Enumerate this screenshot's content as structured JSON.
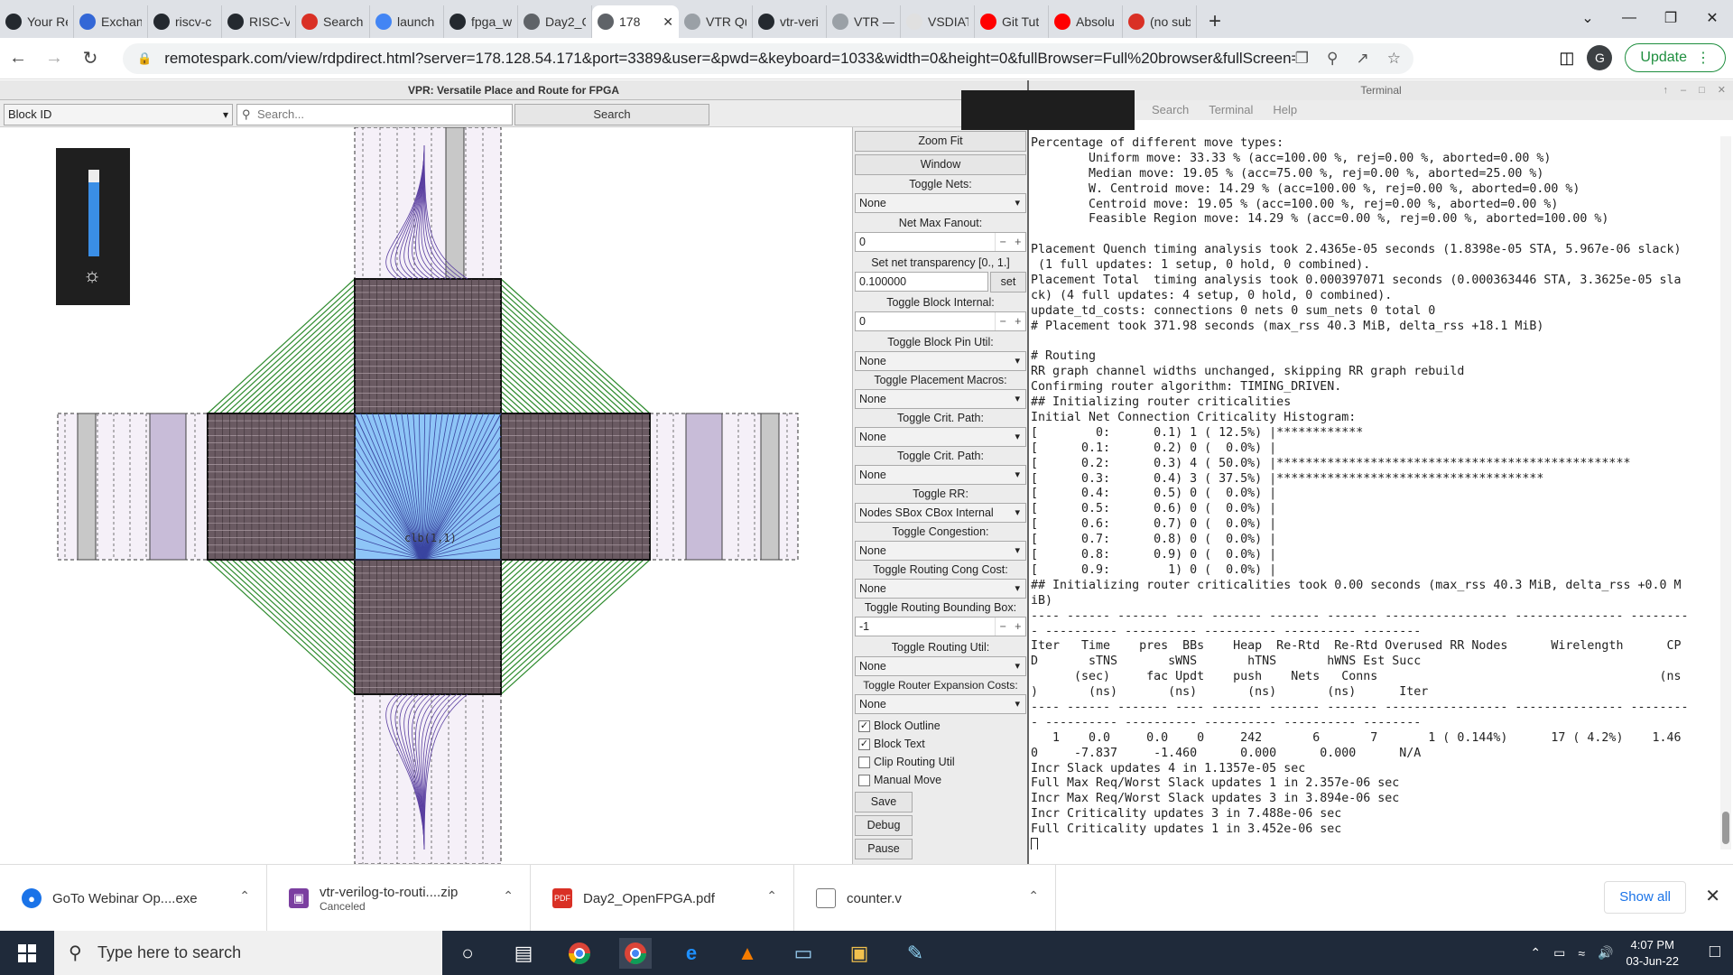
{
  "browser": {
    "tabs": [
      {
        "label": "Your Re",
        "icon": "github-icon",
        "color": "#24292f"
      },
      {
        "label": "Exchan",
        "icon": "exchange-icon",
        "color": "#3367d6"
      },
      {
        "label": "riscv-c",
        "icon": "github-icon",
        "color": "#24292f"
      },
      {
        "label": "RISC-V",
        "icon": "github-icon",
        "color": "#24292f"
      },
      {
        "label": "Search",
        "icon": "gmail-icon",
        "color": "#d93025"
      },
      {
        "label": "launch",
        "icon": "google-icon",
        "color": "#4285f4"
      },
      {
        "label": "fpga_w",
        "icon": "github-icon",
        "color": "#24292f"
      },
      {
        "label": "Day2_C",
        "icon": "globe-icon",
        "color": "#5f6368"
      },
      {
        "label": "178",
        "icon": "globe-icon",
        "color": "#5f6368",
        "active": true
      },
      {
        "label": "VTR Qu",
        "icon": "grid-icon",
        "color": "#9aa0a6"
      },
      {
        "label": "vtr-veri",
        "icon": "github-icon",
        "color": "#24292f"
      },
      {
        "label": "VTR —",
        "icon": "grid-icon",
        "color": "#9aa0a6"
      },
      {
        "label": "VSDIAT",
        "icon": "page-icon",
        "color": "#e0e0e0"
      },
      {
        "label": "Git Tut",
        "icon": "youtube-icon",
        "color": "#ff0000"
      },
      {
        "label": "Absolu",
        "icon": "youtube-icon",
        "color": "#ff0000"
      },
      {
        "label": "(no sub",
        "icon": "gmail-icon",
        "color": "#d93025"
      }
    ],
    "url": "remotespark.com/view/rdpdirect.html?server=178.128.54.171&port=3389&user=&pwd=&keyboard=1033&width=0&height=0&fullBrowser=Full%20browser&fullScreen=Full%...",
    "avatar_letter": "G",
    "update_label": "Update"
  },
  "vpr": {
    "title": "VPR: Versatile Place and Route for FPGA",
    "block_select": "Block ID",
    "search_placeholder": "Search...",
    "search_button": "Search",
    "canvas_label": "clb(1,1)",
    "panel": {
      "zoom_fit": "Zoom Fit",
      "window": "Window",
      "toggle_nets_label": "Toggle Nets:",
      "toggle_nets_value": "None",
      "net_max_fanout_label": "Net Max Fanout:",
      "net_max_fanout_value": "0",
      "net_transparency_label": "Set net transparency [0., 1.]",
      "net_transparency_value": "0.100000",
      "set_button": "set",
      "toggle_block_internal_label": "Toggle Block Internal:",
      "toggle_block_internal_value": "0",
      "toggle_block_pin_util_label": "Toggle Block Pin Util:",
      "toggle_block_pin_util_value": "None",
      "toggle_placement_macros_label": "Toggle Placement Macros:",
      "toggle_placement_macros_value": "None",
      "toggle_crit_path_label": "Toggle Crit. Path:",
      "toggle_crit_path_value": "None",
      "toggle_crit_path2_label": "Toggle Crit. Path:",
      "toggle_crit_path2_value": "None",
      "toggle_rr_label": "Toggle RR:",
      "toggle_rr_value": "Nodes SBox CBox Internal",
      "toggle_congestion_label": "Toggle Congestion:",
      "toggle_congestion_value": "None",
      "toggle_routing_cong_cost_label": "Toggle Routing Cong Cost:",
      "toggle_routing_cong_cost_value": "None",
      "toggle_routing_bbox_label": "Toggle Routing Bounding Box:",
      "toggle_routing_bbox_value": "-1",
      "toggle_routing_util_label": "Toggle Routing Util:",
      "toggle_routing_util_value": "None",
      "toggle_router_exp_cost_label": "Toggle Router Expansion Costs:",
      "toggle_router_exp_cost_value": "None",
      "block_outline": "Block Outline",
      "block_text": "Block Text",
      "clip_routing_util": "Clip Routing Util",
      "manual_move": "Manual Move",
      "save": "Save",
      "debug": "Debug",
      "pause": "Pause"
    }
  },
  "terminal": {
    "title": "Terminal",
    "menu": [
      "Search",
      "Terminal",
      "Help"
    ],
    "lines": [
      "Percentage of different move types:",
      "        Uniform move: 33.33 % (acc=100.00 %, rej=0.00 %, aborted=0.00 %)",
      "        Median move: 19.05 % (acc=75.00 %, rej=0.00 %, aborted=25.00 %)",
      "        W. Centroid move: 14.29 % (acc=100.00 %, rej=0.00 %, aborted=0.00 %)",
      "        Centroid move: 19.05 % (acc=100.00 %, rej=0.00 %, aborted=0.00 %)",
      "        Feasible Region move: 14.29 % (acc=0.00 %, rej=0.00 %, aborted=100.00 %)",
      "",
      "Placement Quench timing analysis took 2.4365e-05 seconds (1.8398e-05 STA, 5.967e-06 slack)",
      " (1 full updates: 1 setup, 0 hold, 0 combined).",
      "Placement Total  timing analysis took 0.000397071 seconds (0.000363446 STA, 3.3625e-05 sla",
      "ck) (4 full updates: 4 setup, 0 hold, 0 combined).",
      "update_td_costs: connections 0 nets 0 sum_nets 0 total 0",
      "# Placement took 371.98 seconds (max_rss 40.3 MiB, delta_rss +18.1 MiB)",
      "",
      "# Routing",
      "RR graph channel widths unchanged, skipping RR graph rebuild",
      "Confirming router algorithm: TIMING_DRIVEN.",
      "## Initializing router criticalities",
      "Initial Net Connection Criticality Histogram:",
      "[        0:      0.1) 1 ( 12.5%) |************",
      "[      0.1:      0.2) 0 (  0.0%) |",
      "[      0.2:      0.3) 4 ( 50.0%) |*************************************************",
      "[      0.3:      0.4) 3 ( 37.5%) |*************************************",
      "[      0.4:      0.5) 0 (  0.0%) |",
      "[      0.5:      0.6) 0 (  0.0%) |",
      "[      0.6:      0.7) 0 (  0.0%) |",
      "[      0.7:      0.8) 0 (  0.0%) |",
      "[      0.8:      0.9) 0 (  0.0%) |",
      "[      0.9:        1) 0 (  0.0%) |",
      "## Initializing router criticalities took 0.00 seconds (max_rss 40.3 MiB, delta_rss +0.0 M",
      "iB)",
      "---- ------ ------- ---- ------- ------- ------- ----------------- --------------- --------",
      "- ---------- ---------- ---------- ---------- --------",
      "Iter   Time    pres  BBs    Heap  Re-Rtd  Re-Rtd Overused RR Nodes      Wirelength      CP",
      "D       sTNS       sWNS       hTNS       hWNS Est Succ",
      "      (sec)     fac Updt    push    Nets   Conns                                       (ns",
      ")       (ns)       (ns)       (ns)       (ns)      Iter",
      "---- ------ ------- ---- ------- ------- ------- ----------------- --------------- --------",
      "- ---------- ---------- ---------- ---------- --------",
      "   1    0.0     0.0    0     242       6       7       1 ( 0.144%)      17 ( 4.2%)    1.46",
      "0     -7.837     -1.460      0.000      0.000      N/A",
      "Incr Slack updates 4 in 1.1357e-05 sec",
      "Full Max Req/Worst Slack updates 1 in 2.357e-06 sec",
      "Incr Max Req/Worst Slack updates 3 in 3.894e-06 sec",
      "Incr Criticality updates 3 in 7.488e-06 sec",
      "Full Criticality updates 1 in 3.452e-06 sec"
    ]
  },
  "downloads": [
    {
      "name": "GoTo Webinar Op....exe",
      "sub": ""
    },
    {
      "name": "vtr-verilog-to-routi....zip",
      "sub": "Canceled"
    },
    {
      "name": "Day2_OpenFPGA.pdf",
      "sub": ""
    },
    {
      "name": "counter.v",
      "sub": ""
    }
  ],
  "show_all": "Show all",
  "taskbar": {
    "search_placeholder": "Type here to search",
    "time": "4:07 PM",
    "date": "03-Jun-22"
  }
}
